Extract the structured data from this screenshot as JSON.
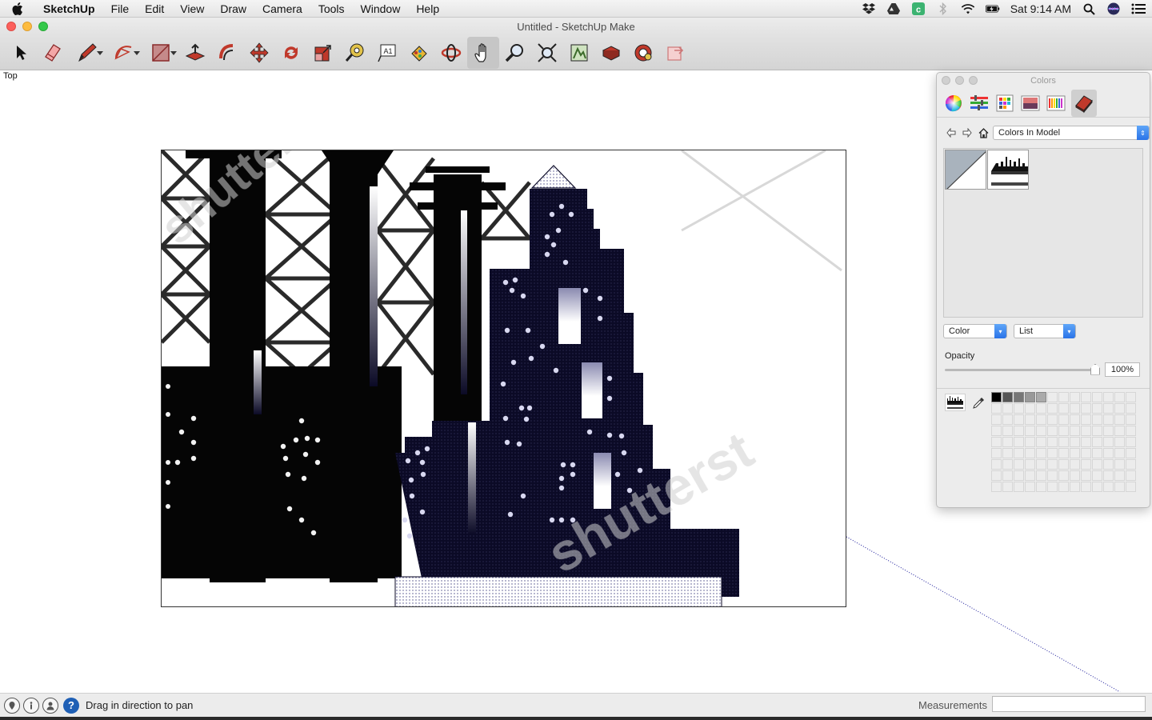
{
  "menubar": {
    "app_name": "SketchUp",
    "items": [
      "File",
      "Edit",
      "View",
      "Draw",
      "Camera",
      "Tools",
      "Window",
      "Help"
    ],
    "clock": "Sat 9:14 AM"
  },
  "window": {
    "title": "Untitled - SketchUp Make"
  },
  "toolbar": {
    "tools": [
      "select",
      "eraser",
      "line",
      "arc",
      "shape",
      "push-pull",
      "follow-me",
      "move",
      "rotate",
      "scale",
      "tape-measure",
      "text",
      "paint-bucket",
      "orbit",
      "pan",
      "zoom",
      "zoom-extents",
      "3d-warehouse",
      "extension-warehouse",
      "layout",
      "send-to-layout"
    ],
    "active_tool": "pan"
  },
  "viewport": {
    "view_name": "Top",
    "watermark_text": "shutterst"
  },
  "colors_panel": {
    "title": "Colors",
    "library": "Colors In Model",
    "view_mode": "Color",
    "list_mode": "List",
    "opacity_label": "Opacity",
    "opacity_value": "100%",
    "opacity_fraction": 1.0,
    "saved_colors": [
      "#000000",
      "#555555",
      "#777777",
      "#999999",
      "#aaaaaa"
    ]
  },
  "statusbar": {
    "hint": "Drag in direction to pan",
    "measurements_label": "Measurements",
    "measurements_value": ""
  },
  "colors": {
    "accent": "#2a73e8",
    "building_fill": "#0b0a26",
    "window_dot": "#d8d8f0"
  }
}
